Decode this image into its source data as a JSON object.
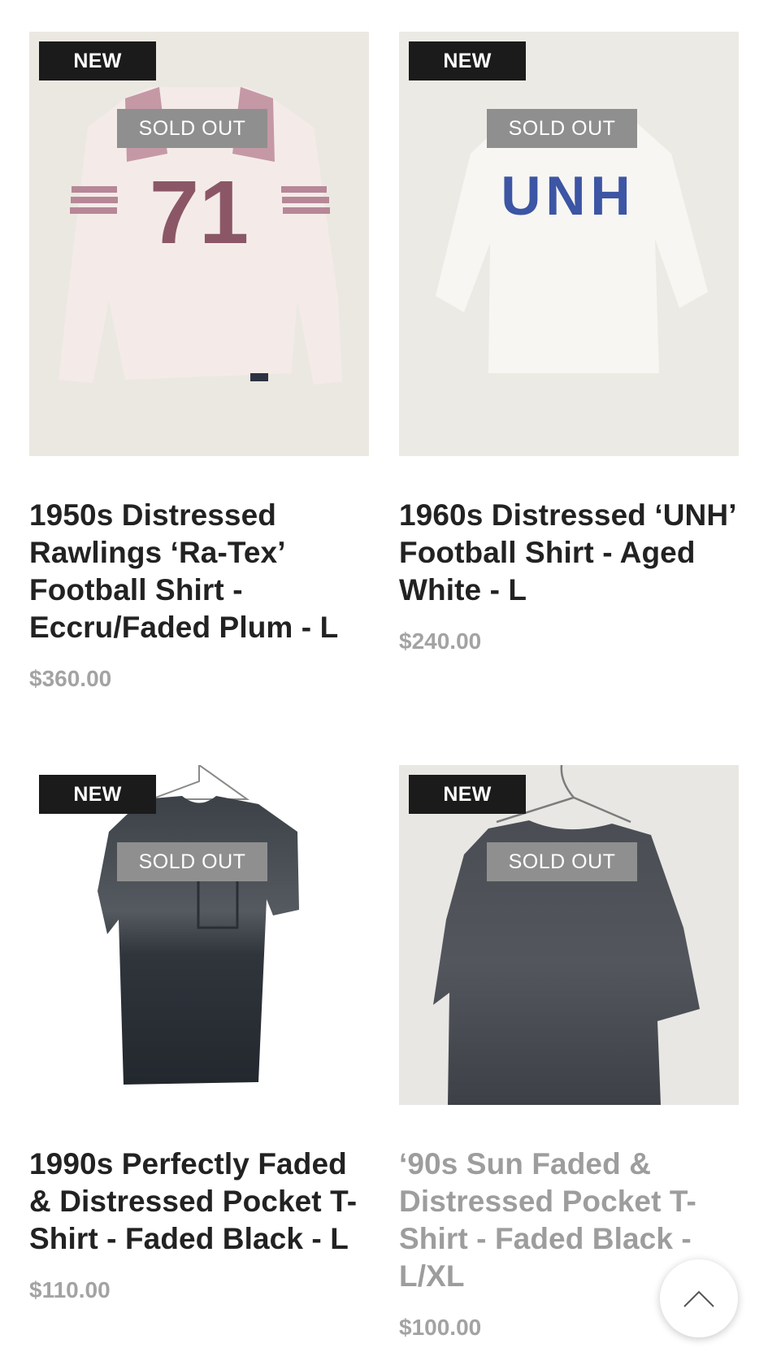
{
  "products": [
    {
      "badge_new": "NEW",
      "badge_status": "SOLD OUT",
      "title": "1950s Distressed Rawlings ‘Ra-Tex’ Football Shirt - Eccru/Faded Plum - L",
      "price": "$360.00",
      "image_text": "71"
    },
    {
      "badge_new": "NEW",
      "badge_status": "SOLD OUT",
      "title": "1960s Distressed ‘UNH’ Football Shirt - Aged White - L",
      "price": "$240.00",
      "image_text": "UNH"
    },
    {
      "badge_new": "NEW",
      "badge_status": "SOLD OUT",
      "title": "1990s Perfectly Faded & Distressed Pocket T-Shirt - Faded Black - L",
      "price": "$110.00"
    },
    {
      "badge_new": "NEW",
      "badge_status": "SOLD OUT",
      "title": "‘90s Sun Faded & Distressed Pocket T-Shirt - Faded Black - L/XL",
      "price": "$100.00"
    }
  ],
  "scroll_top": {
    "icon": "chevron-up-icon"
  },
  "colors": {
    "badge_new_bg": "#1b1b1b",
    "badge_sold_bg": "#8f8f8f",
    "title_text": "#222222",
    "title_muted_text": "#9d9d9d",
    "price_text": "#a3a3a3"
  }
}
